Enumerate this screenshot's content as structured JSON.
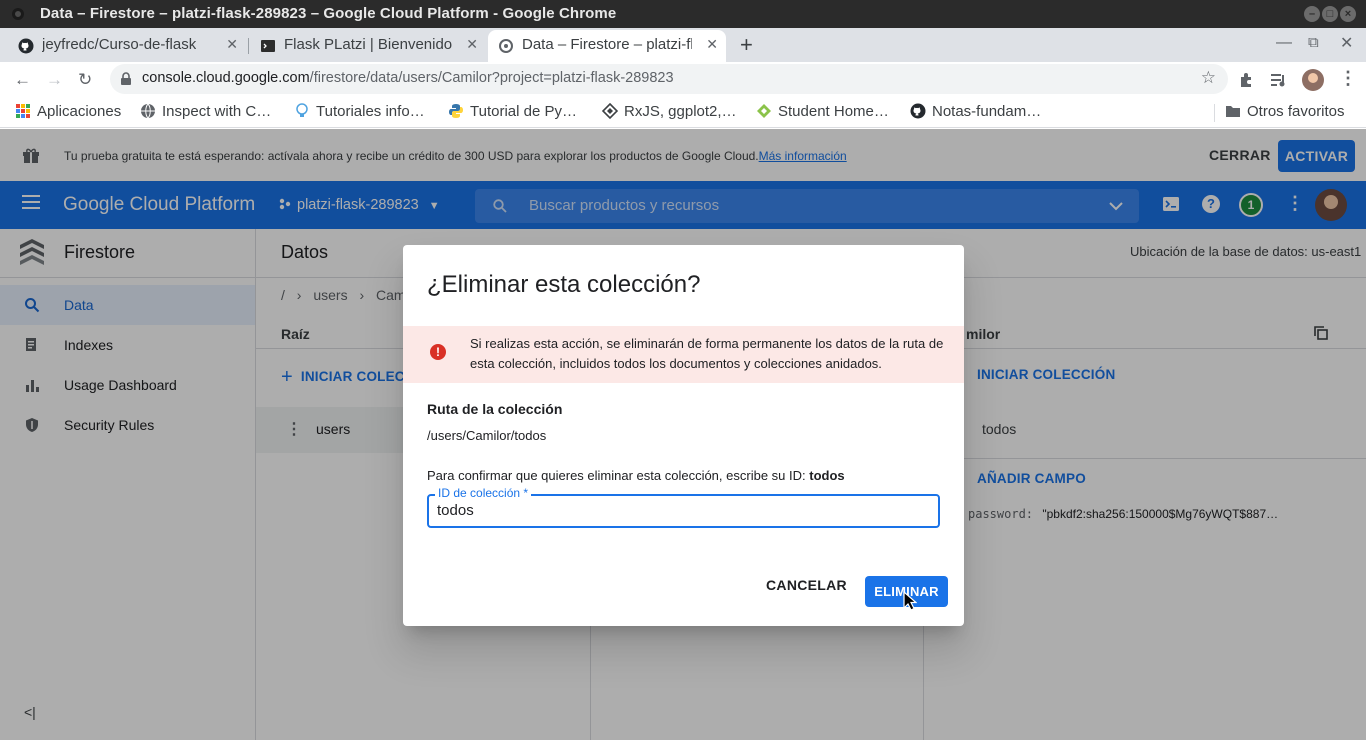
{
  "window": {
    "title": "Data – Firestore – platzi-flask-289823 – Google Cloud Platform - Google Chrome"
  },
  "tabs": [
    {
      "label": "jeyfredc/Curso-de-flask",
      "icon": "github-icon"
    },
    {
      "label": "Flask PLatzi | Bienvenido",
      "icon": "terminal-icon"
    },
    {
      "label": "Data – Firestore – platzi-fl",
      "icon": "gcp-icon",
      "active": true
    }
  ],
  "address": {
    "host": "console.cloud.google.com",
    "path": "/firestore/data/users/Camilor?project=platzi-flask-289823"
  },
  "bookmarks": [
    {
      "label": "Aplicaciones",
      "icon": "apps-grid-icon"
    },
    {
      "label": "Inspect with C…",
      "icon": "globe-icon"
    },
    {
      "label": "Tutoriales info…",
      "icon": "bulb-icon"
    },
    {
      "label": "Tutorial de Py…",
      "icon": "python-icon"
    },
    {
      "label": "RxJS, ggplot2,…",
      "icon": "diamond-icon"
    },
    {
      "label": "Student Home…",
      "icon": "leaf-icon"
    },
    {
      "label": "Notas-fundam…",
      "icon": "github-icon"
    },
    {
      "label": "Otros favoritos",
      "icon": "folder-icon"
    }
  ],
  "trial": {
    "message": "Tu prueba gratuita te está esperando: actívala ahora y recibe un crédito de 300 USD para explorar los productos de Google Cloud.",
    "link": "Más información",
    "dismiss": "CERRAR",
    "activate": "ACTIVAR"
  },
  "header": {
    "brand": "Google Cloud Platform",
    "project": "platzi-flask-289823",
    "search_placeholder": "Buscar productos y recursos",
    "notifications": "1"
  },
  "sidebar": {
    "product": "Firestore",
    "items": [
      {
        "label": "Data",
        "icon": "search-icon",
        "active": true
      },
      {
        "label": "Indexes",
        "icon": "indexes-icon"
      },
      {
        "label": "Usage Dashboard",
        "icon": "bar-chart-icon"
      },
      {
        "label": "Security Rules",
        "icon": "shield-icon"
      }
    ]
  },
  "main": {
    "title": "Datos",
    "location": "Ubicación de la base de datos: us-east1",
    "breadcrumb": [
      "/",
      "users",
      "Cam"
    ],
    "root_pane": {
      "header": "Raíz",
      "start_collection": "INICIAR COLECCIÓN",
      "items": [
        "users"
      ]
    },
    "doc_pane": {
      "header": "milor",
      "start_collection": "INICIAR COLECCIÓN",
      "collections": [
        "todos"
      ],
      "add_field": "AÑADIR CAMPO",
      "field_key": "password:",
      "field_value": "\"pbkdf2:sha256:150000$Mg76yWQT$887…"
    }
  },
  "dialog": {
    "title": "¿Eliminar esta colección?",
    "warning": "Si realizas esta acción, se eliminarán de forma permanente los datos de la ruta de esta colección, incluidos todos los documentos y colecciones anidados.",
    "path_label": "Ruta de la colección",
    "path": "/users/Camilor/todos",
    "confirm_text": "Para confirmar que quieres eliminar esta colección, escribe su ID:",
    "confirm_id": "todos",
    "field_label": "ID de colección *",
    "field_value": "todos",
    "cancel": "CANCELAR",
    "delete": "ELIMINAR"
  }
}
